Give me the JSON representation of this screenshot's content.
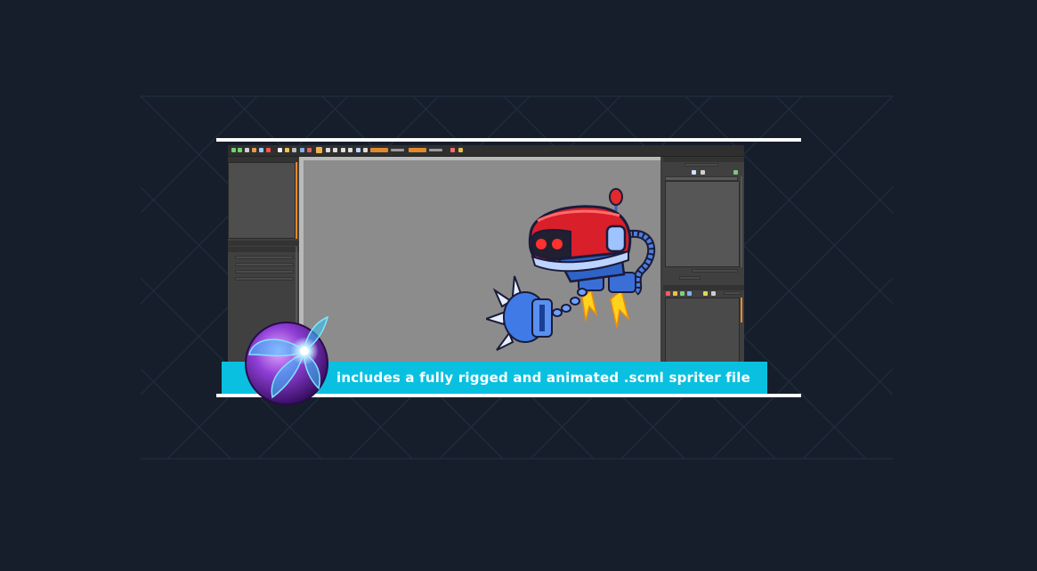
{
  "banner": {
    "caption": "includes a fully rigged and animated .scml spriter file",
    "accent_color": "#0ac0e0",
    "background_color": "#161e2b"
  },
  "spriter_window": {
    "toolbar": {
      "icons": [
        "undo-icon",
        "redo-icon",
        "pointer-icon",
        "brush-icon",
        "copy-icon",
        "record-icon",
        "new-file-icon",
        "open-file-icon",
        "save-icon",
        "image-icon",
        "export-icon",
        "move-icon",
        "fullscreen-icon",
        "tile-icon",
        "grid-icon",
        "split-icon",
        "monitor-icon",
        "expand-icon"
      ]
    },
    "left_panel": {
      "fields": [
        "x",
        "y",
        "scale",
        "alpha"
      ]
    },
    "right_panel": {},
    "canvas": {
      "background_color": "#8c8c8c",
      "character": "flying robot with spiked mace arm and jet thrusters"
    }
  }
}
